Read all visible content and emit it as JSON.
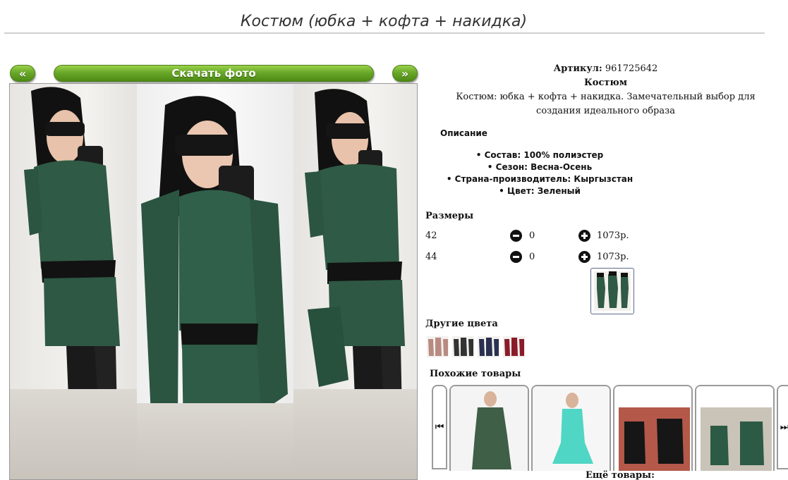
{
  "page": {
    "title": "Костюм (юбка + кофта + накидка)"
  },
  "gallery": {
    "prev_label": "«",
    "next_label": "»",
    "download_label": "Скачать фото"
  },
  "product": {
    "sku_label": "Артикул:",
    "sku_value": "961725642",
    "type": "Костюм",
    "description": "Костюм: юбка + кофта + накидка. Замечательный выбор для создания идеального образа"
  },
  "description_section": {
    "heading": "Описание",
    "properties": [
      "Состав: 100% полиэстер",
      "Сезон: Весна-Осень",
      "Страна-производитель: Кыргызстан",
      "Цвет: Зеленый"
    ]
  },
  "sizes": {
    "heading": "Размеры",
    "rows": [
      {
        "size": "42",
        "qty": "0",
        "price": "1073р."
      },
      {
        "size": "44",
        "qty": "0",
        "price": "1073р."
      }
    ]
  },
  "colors": {
    "heading": "Другие цвета",
    "swatches": [
      "#b98a80",
      "#333333",
      "#2a3050",
      "#8a1c2a"
    ]
  },
  "similar": {
    "heading": "Похожие товары",
    "more_label": "Ещё товары:"
  },
  "theme": {
    "accent_green": "#6aa82a",
    "dress_green": "#2f5a45"
  }
}
